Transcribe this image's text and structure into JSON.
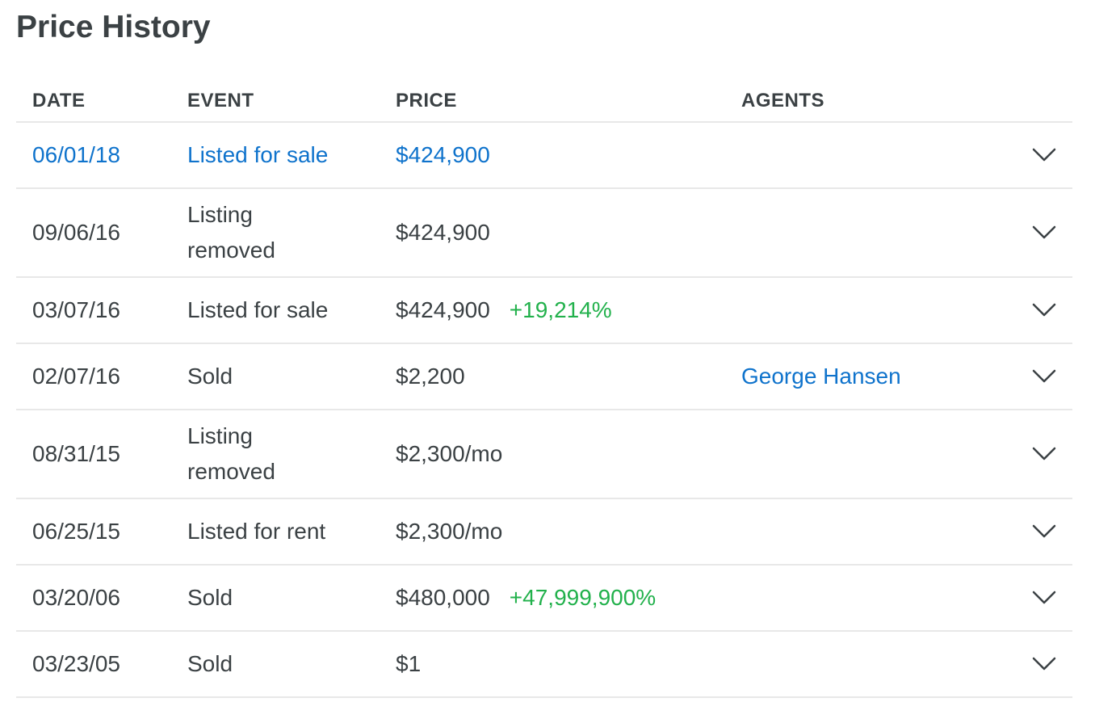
{
  "section": {
    "title": "Price History"
  },
  "table": {
    "headers": {
      "date": "DATE",
      "event": "EVENT",
      "price": "PRICE",
      "agents": "AGENTS"
    },
    "rows": [
      {
        "date": "06/01/18",
        "event": "Listed for sale",
        "price": "$424,900",
        "change": "",
        "agent": "",
        "highlighted": true
      },
      {
        "date": "09/06/16",
        "event": "Listing removed",
        "price": "$424,900",
        "change": "",
        "agent": ""
      },
      {
        "date": "03/07/16",
        "event": "Listed for sale",
        "price": "$424,900",
        "change": "+19,214%",
        "agent": ""
      },
      {
        "date": "02/07/16",
        "event": "Sold",
        "price": "$2,200",
        "change": "",
        "agent": "George Hansen"
      },
      {
        "date": "08/31/15",
        "event": "Listing removed",
        "price": "$2,300/mo",
        "change": "",
        "agent": ""
      },
      {
        "date": "06/25/15",
        "event": "Listed for rent",
        "price": "$2,300/mo",
        "change": "",
        "agent": ""
      },
      {
        "date": "03/20/06",
        "event": "Sold",
        "price": "$480,000",
        "change": "+47,999,900%",
        "agent": ""
      },
      {
        "date": "03/23/05",
        "event": "Sold",
        "price": "$1",
        "change": "",
        "agent": ""
      }
    ],
    "expand_icon": "chevron-down-icon"
  },
  "colors": {
    "text": "#3b4144",
    "highlight": "#0f73cc",
    "positive_change": "#22b14c",
    "divider": "#e8e8e8"
  }
}
